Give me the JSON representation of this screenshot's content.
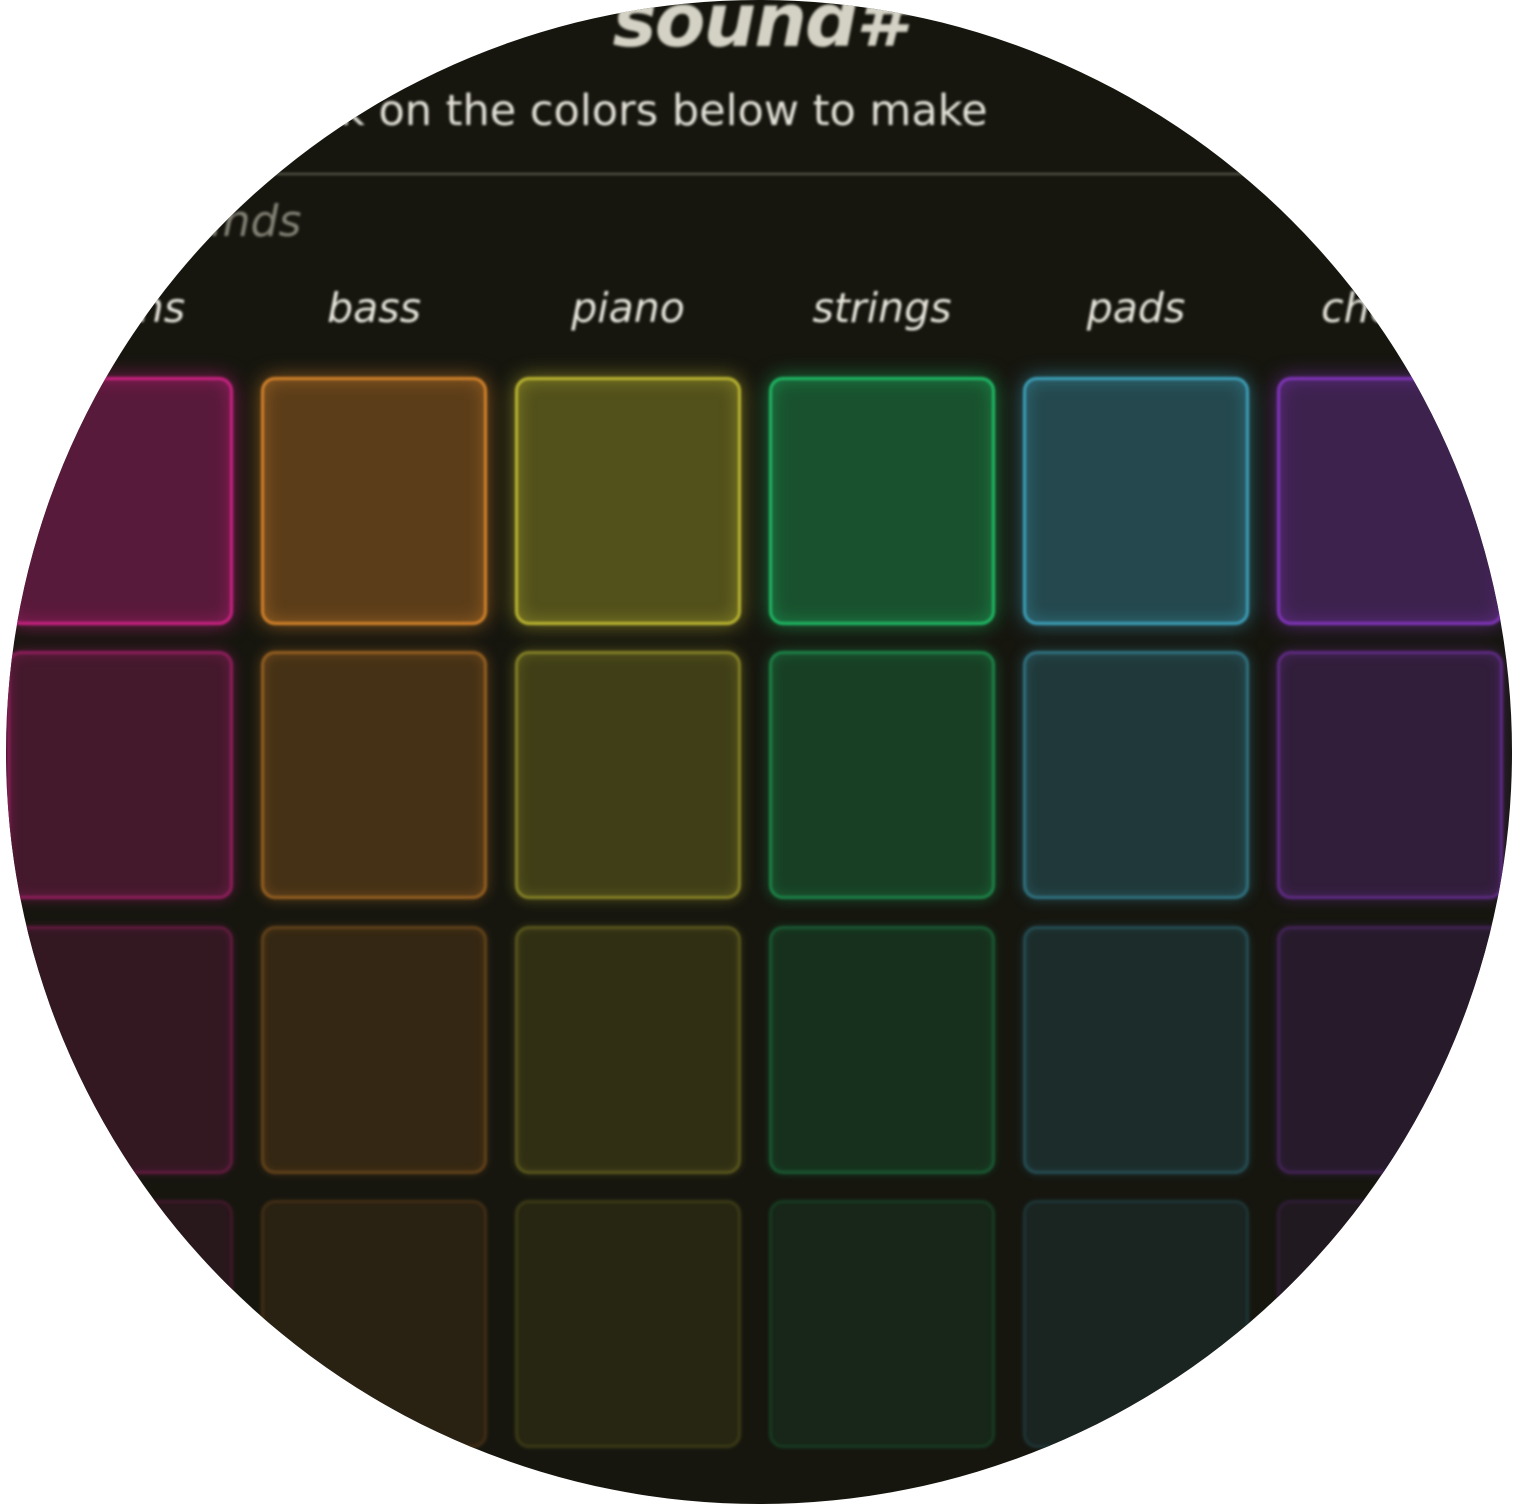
{
  "app": {
    "title": "sound#",
    "instructions": "(or touch the screen) or click on the colors below to make",
    "section_heading": "notes + sounds"
  },
  "columns": [
    {
      "label": "drums",
      "color": "#d9238c"
    },
    {
      "label": "bass",
      "color": "#e08a2c"
    },
    {
      "label": "piano",
      "color": "#c6c033"
    },
    {
      "label": "strings",
      "color": "#1fc46a"
    },
    {
      "label": "pads",
      "color": "#3fa8c4"
    },
    {
      "label": "chords",
      "color": "#8a38c8"
    }
  ],
  "rows": [
    {
      "level": 1.0
    },
    {
      "level": 0.62
    },
    {
      "level": 0.32
    },
    {
      "level": 0.12
    }
  ]
}
